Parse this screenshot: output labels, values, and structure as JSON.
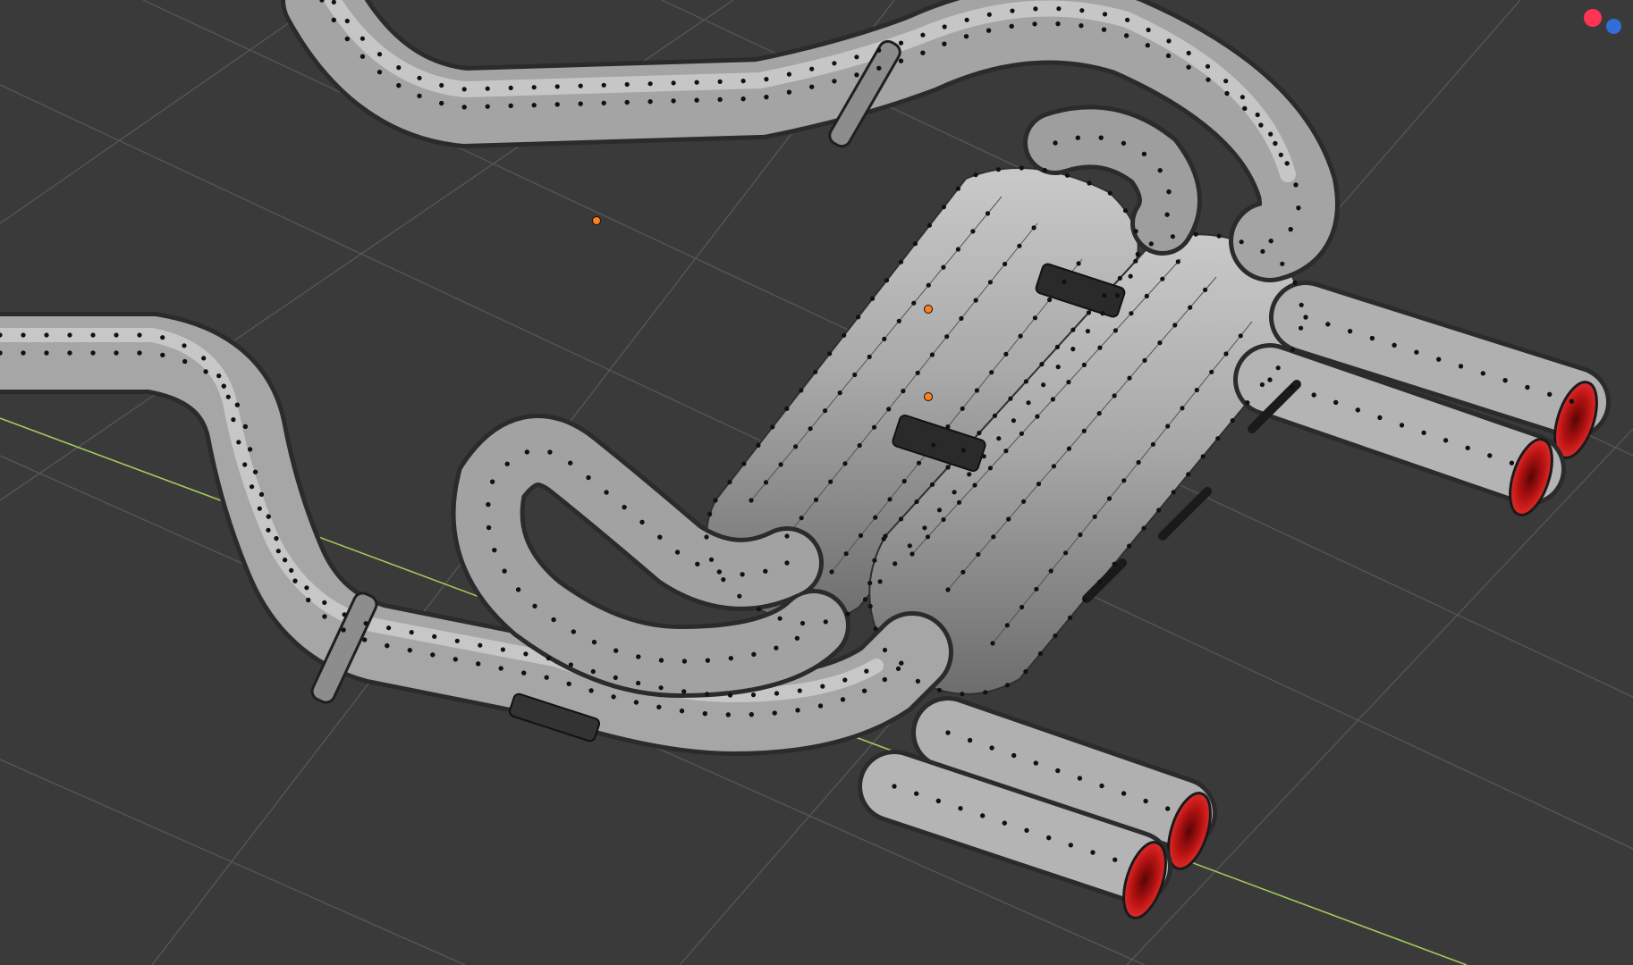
{
  "viewport": {
    "background": "#3a3a3a",
    "grid_color": "#575757",
    "x_axis_color": "#a4c85a",
    "mesh_color": "#9c9c9c",
    "vertex_color": "#111111",
    "tip_color": "#cc2020",
    "origin_color": "#ff7f1a"
  },
  "gizmo": {
    "x_axis_color": "#ff3352",
    "y_axis_color": "#2f6fd6"
  },
  "objects": [
    {
      "name": "upper-left-intake-pipe"
    },
    {
      "name": "left-inlet-pipe"
    },
    {
      "name": "upper-muffler-canister"
    },
    {
      "name": "lower-muffler-canister"
    },
    {
      "name": "lower-crossover-pipe"
    },
    {
      "name": "right-upper-exhaust-tip"
    },
    {
      "name": "right-lower-exhaust-tip"
    },
    {
      "name": "bottom-upper-exhaust-tip"
    },
    {
      "name": "bottom-lower-exhaust-tip"
    }
  ]
}
